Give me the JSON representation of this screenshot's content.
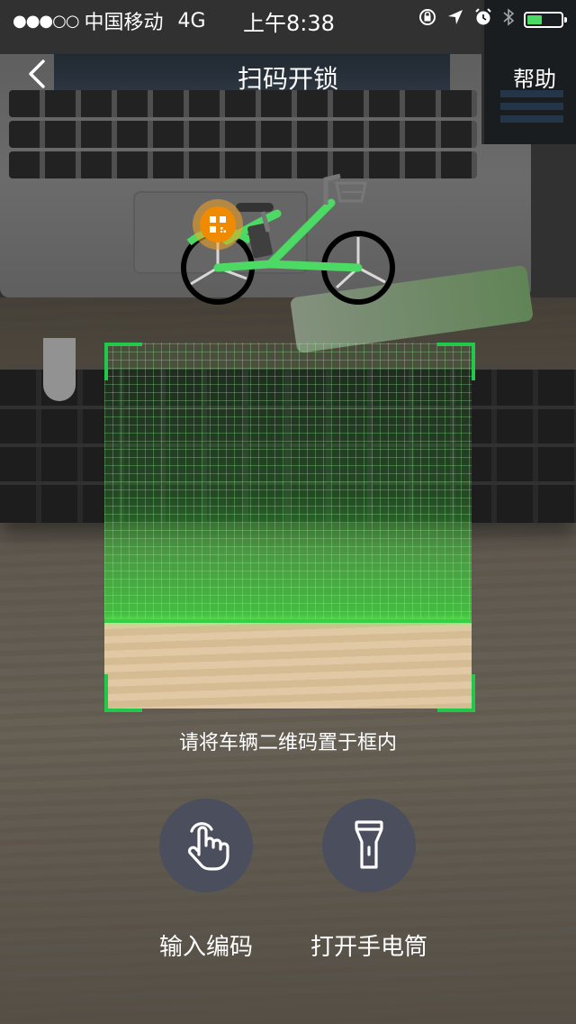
{
  "status_bar": {
    "signal": "●●●○○",
    "carrier": "中国移动",
    "network": "4G",
    "time": "上午8:38",
    "battery_level": 0.45,
    "icons": [
      "orientation-lock-icon",
      "location-icon",
      "alarm-icon",
      "bluetooth-icon",
      "battery-icon"
    ]
  },
  "nav": {
    "title": "扫码开锁",
    "help": "帮助",
    "back_icon": "chevron-left-icon"
  },
  "scan": {
    "hint": "请将车辆二维码置于框内",
    "accent_color": "#21c84a"
  },
  "actions": {
    "enter_code": {
      "label": "输入编码",
      "icon": "tap-finger-icon"
    },
    "flashlight": {
      "label": "打开手电筒",
      "icon": "flashlight-icon"
    }
  },
  "colors": {
    "button_bg": "#4a4e5d",
    "bike_green": "#4cd964",
    "qr_badge": "#f5a623"
  }
}
